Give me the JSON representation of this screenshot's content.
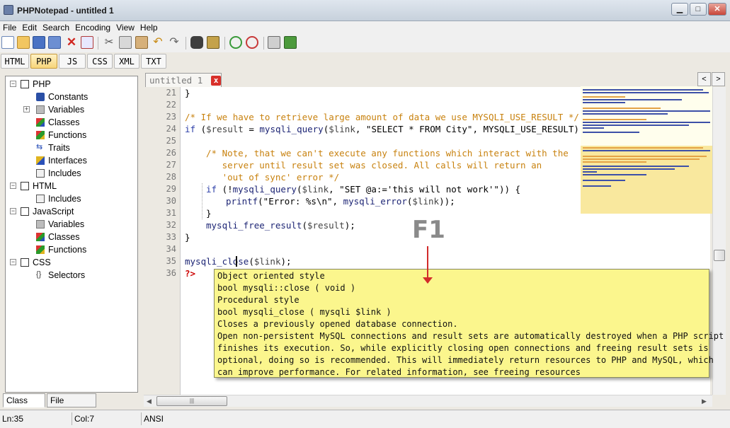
{
  "window": {
    "title": "PHPNotepad - untitled 1",
    "min_glyph": "▁",
    "max_glyph": "□",
    "close_glyph": "✕"
  },
  "menu": [
    "File",
    "Edit",
    "Search",
    "Encoding",
    "View",
    "Help"
  ],
  "toolbar": {
    "buttons": [
      "new-file-icon",
      "open-file-icon",
      "save-icon",
      "save-all-icon",
      "close-file-icon",
      "close-all-icon",
      "cut-icon",
      "copy-icon",
      "paste-icon",
      "undo-icon",
      "redo-icon",
      "find-icon",
      "replace-icon",
      "zoom-in-icon",
      "zoom-out-icon",
      "print-icon",
      "exit-icon"
    ]
  },
  "language_tabs": [
    "HTML",
    "PHP",
    "JS",
    "CSS",
    "XML",
    "TXT"
  ],
  "active_language": "PHP",
  "tree": [
    {
      "label": "PHP",
      "level": 0,
      "icon": "php-node-icon"
    },
    {
      "label": "Constants",
      "level": 1,
      "icon": "constant-icon"
    },
    {
      "label": "Variables",
      "level": 1,
      "icon": "variable-icon"
    },
    {
      "label": "Classes",
      "level": 1,
      "icon": "class-icon"
    },
    {
      "label": "Functions",
      "level": 1,
      "icon": "function-icon"
    },
    {
      "label": "Traits",
      "level": 1,
      "icon": "trait-icon"
    },
    {
      "label": "Interfaces",
      "level": 1,
      "icon": "interface-icon"
    },
    {
      "label": "Includes",
      "level": 1,
      "icon": "include-icon"
    },
    {
      "label": "HTML",
      "level": 0,
      "icon": "html-node-icon"
    },
    {
      "label": "Includes",
      "level": 1,
      "icon": "include-icon"
    },
    {
      "label": "JavaScript",
      "level": 0,
      "icon": "js-node-icon"
    },
    {
      "label": "Variables",
      "level": 1,
      "icon": "variable-icon"
    },
    {
      "label": "Classes",
      "level": 1,
      "icon": "class-icon"
    },
    {
      "label": "Functions",
      "level": 1,
      "icon": "function-icon"
    },
    {
      "label": "CSS",
      "level": 0,
      "icon": "css-node-icon"
    },
    {
      "label": "Selectors",
      "level": 1,
      "icon": "selector-icon"
    }
  ],
  "side_tabs": [
    "Class View",
    "File Explorer"
  ],
  "document_tab": {
    "title": "untitled 1",
    "close_glyph": "x"
  },
  "nav": {
    "prev": "<",
    "next": ">"
  },
  "line_numbers": [
    "21",
    "22",
    "23",
    "24",
    "25",
    "26",
    "27",
    "28",
    "29",
    "30",
    "31",
    "32",
    "33",
    "34",
    "35",
    "36"
  ],
  "code": {
    "l21": "}",
    "l23": "/* If we have to retrieve large amount of data we use MYSQLI_USE_RESULT */",
    "l24_kw": "if",
    "l24_a": " (",
    "l24_var": "$result",
    "l24_b": " = ",
    "l24_fn": "mysqli_query",
    "l24_c": "(",
    "l24_var2": "$link",
    "l24_d": ", \"SELECT * FROM City\", MYSQLI_USE_RESULT)) {",
    "l26": "/* Note, that we can't execute any functions which interact with the",
    "l27": "   server until result set was closed. All calls will return an",
    "l28": "   'out of sync' error */",
    "l29_kw": "if",
    "l29_a": " (!",
    "l29_fn": "mysqli_query",
    "l29_b": "(",
    "l29_var": "$link",
    "l29_c": ", \"SET @a:='this will not work'\")) {",
    "l30_fn": "printf",
    "l30_a": "(\"Error: %s\\n\", ",
    "l30_fn2": "mysqli_error",
    "l30_b": "(",
    "l30_var": "$link",
    "l30_c": "));",
    "l31": "}",
    "l32_fn": "mysqli_free_result",
    "l32_a": "(",
    "l32_var": "$result",
    "l32_b": ");",
    "l33": "}",
    "l35_fn": "mysqli_close",
    "l35_a": "(",
    "l35_var": "$link",
    "l35_b": ");",
    "l36": "?>"
  },
  "tooltip": [
    "Object oriented style",
    "bool mysqli::close ( void )",
    "Procedural style",
    "bool mysqli_close ( mysqli $link )",
    "Closes a previously opened database connection.",
    "Open non-persistent MySQL connections and result sets are automatically destroyed when a PHP script",
    "finishes its execution. So, while explicitly closing open connections and freeing result sets is",
    "optional, doing so is recommended. This will immediately return resources to PHP and MySQL, which",
    "can improve performance. For related information, see freeing resources"
  ],
  "annotation": "F1",
  "status": {
    "line": "Ln:35",
    "col": "Col:7",
    "encoding": "ANSI"
  },
  "colors": {
    "comment": "#c8820f",
    "keyword": "#2d3fa8",
    "php_tag": "#cc0000",
    "tooltip_bg": "#fbf68d",
    "arrow": "#d22b2b"
  }
}
